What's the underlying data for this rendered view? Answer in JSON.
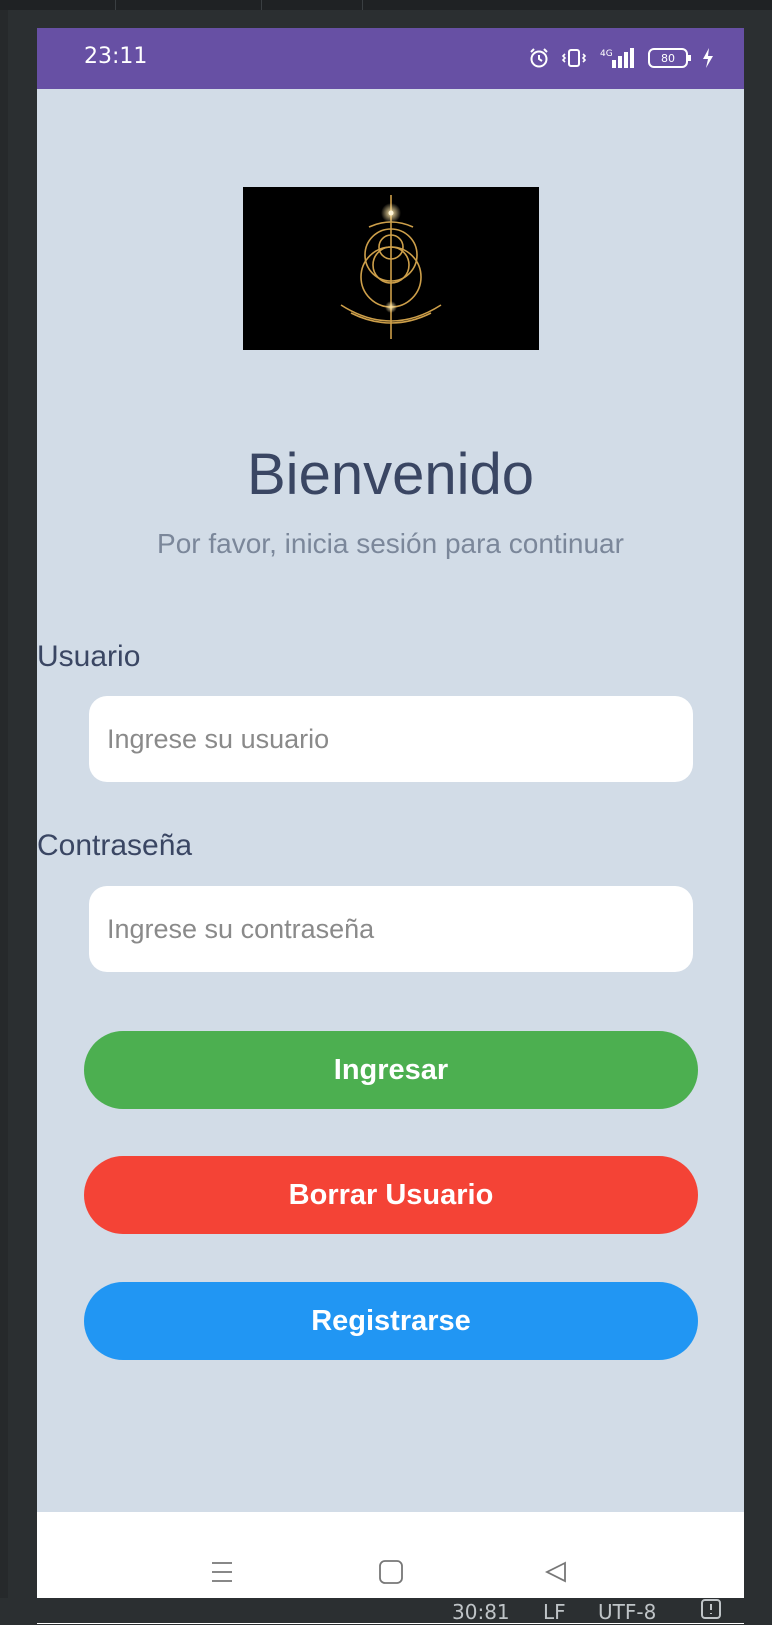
{
  "ide": {
    "status_items": [
      "30:81",
      "LF",
      "UTF-8"
    ]
  },
  "status_bar": {
    "time": "23:11",
    "battery": "80",
    "network": "4G",
    "icons": [
      "alarm-icon",
      "vibrate-icon",
      "signal-icon",
      "battery-icon",
      "charging-icon"
    ]
  },
  "login": {
    "title": "Bienvenido",
    "subtitle": "Por favor, inicia sesión para continuar",
    "user_label": "Usuario",
    "user_placeholder": "Ingrese su usuario",
    "password_label": "Contraseña",
    "password_placeholder": "Ingrese su contraseña",
    "login_button": "Ingresar",
    "delete_button": "Borrar Usuario",
    "register_button": "Registrarse"
  },
  "nav_bar": {
    "icons": [
      "menu-icon",
      "home-icon",
      "back-icon"
    ]
  },
  "colors": {
    "status_bar": "#6750a4",
    "background": "#d2dce7",
    "login_button": "#4caf50",
    "delete_button": "#f44336",
    "register_button": "#2196f3",
    "title_text": "#3a4663"
  }
}
